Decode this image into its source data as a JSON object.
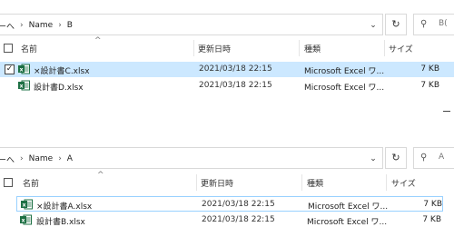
{
  "pane_b": {
    "breadcrumb": {
      "prefix": "ーへ",
      "items": [
        "Name",
        "B"
      ]
    },
    "search_placeholder": "B(",
    "columns": {
      "name": "名前",
      "date": "更新日時",
      "type": "種類",
      "size": "サイズ"
    },
    "files": [
      {
        "name": "×設計書C.xlsx",
        "date": "2021/03/18 22:15",
        "type": "Microsoft Excel ワ...",
        "size": "7 KB"
      },
      {
        "name": "設計書D.xlsx",
        "date": "2021/03/18 22:15",
        "type": "Microsoft Excel ワ...",
        "size": "7 KB"
      }
    ]
  },
  "pane_a": {
    "breadcrumb": {
      "prefix": "ーへ",
      "items": [
        "Name",
        "A"
      ]
    },
    "search_placeholder": "A",
    "columns": {
      "name": "名前",
      "date": "更新日時",
      "type": "種類",
      "size": "サイズ"
    },
    "files": [
      {
        "name": "×設計書A.xlsx",
        "date": "2021/03/18 22:15",
        "type": "Microsoft Excel ワ...",
        "size": "7 KB"
      },
      {
        "name": "設計書B.xlsx",
        "date": "2021/03/18 22:15",
        "type": "Microsoft Excel ワ...",
        "size": "7 KB"
      }
    ]
  },
  "icons": {
    "excel": "excel-file-icon",
    "refresh": "refresh-icon",
    "search": "search-icon",
    "dropdown": "chevron-down-icon"
  },
  "colors": {
    "selection": "#cce8ff",
    "focus_border": "#99d1ff",
    "excel_green": "#1d7044"
  }
}
